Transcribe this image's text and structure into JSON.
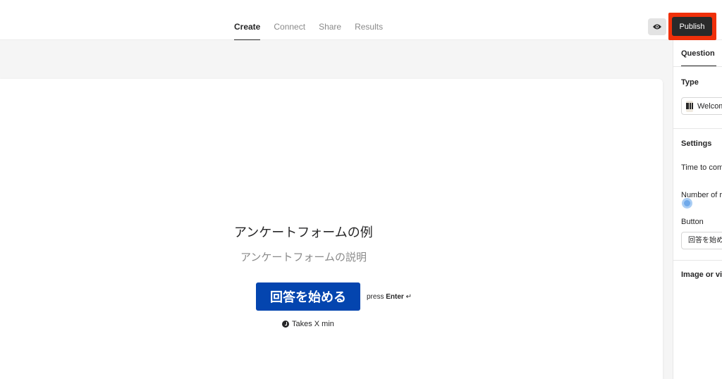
{
  "nav": {
    "tabs": [
      {
        "label": "Create",
        "active": true
      },
      {
        "label": "Connect",
        "active": false
      },
      {
        "label": "Share",
        "active": false
      },
      {
        "label": "Results",
        "active": false
      }
    ],
    "preview_icon": "eye-icon",
    "publish_label": "Publish"
  },
  "form": {
    "title": "アンケートフォームの例",
    "description": "アンケートフォームの説明",
    "start_button": "回答を始める",
    "press_prefix": "press",
    "press_key": "Enter",
    "press_icon": "↵",
    "time_icon": "clock-icon",
    "time_text": "Takes X min"
  },
  "panel": {
    "tab": "Question",
    "type_label": "Type",
    "type_value": "Welcome Screen",
    "settings_label": "Settings",
    "time_to_complete_label": "Time to complete",
    "number_of_label": "Number of respondents",
    "button_label": "Button",
    "button_value": "回答を始める",
    "image_label": "Image or video"
  },
  "colors": {
    "accent_button": "#0445af",
    "publish_bg": "#2a2a2a",
    "highlight": "#f0300a",
    "toggle": "#6fa9ea"
  }
}
